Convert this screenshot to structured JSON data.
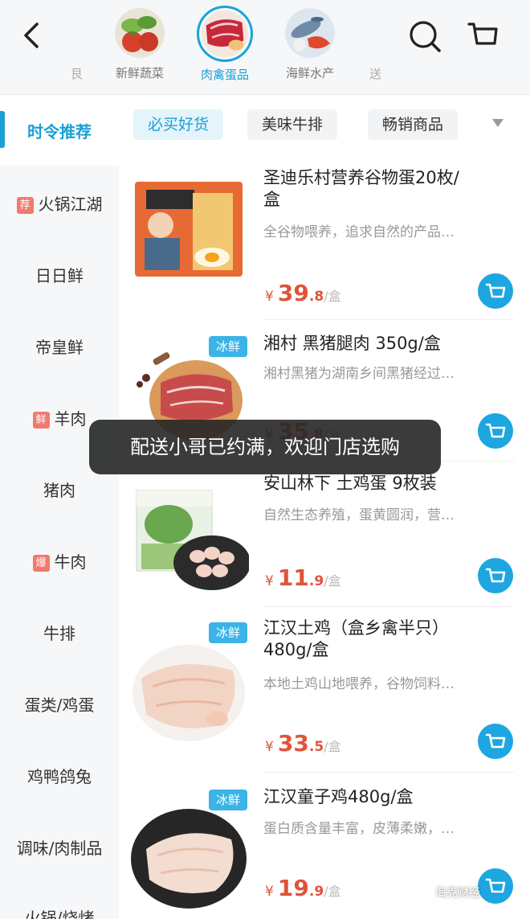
{
  "header": {
    "categories": [
      {
        "label": "新鲜蔬菜",
        "icon": "vegetables-icon",
        "active": false
      },
      {
        "label": "肉禽蛋品",
        "icon": "meat-icon",
        "active": true
      },
      {
        "label": "海鲜水产",
        "icon": "seafood-icon",
        "active": false
      }
    ],
    "left_edge_label": "艮",
    "right_edge_label": "送"
  },
  "sidebar": {
    "active": "时令推荐",
    "items": [
      {
        "label": "火锅江湖",
        "tag": "荐"
      },
      {
        "label": "日日鲜",
        "tag": ""
      },
      {
        "label": "帝皇鲜",
        "tag": ""
      },
      {
        "label": "羊肉",
        "tag": "鲜"
      },
      {
        "label": "猪肉",
        "tag": ""
      },
      {
        "label": "牛肉",
        "tag": "爆"
      },
      {
        "label": "牛排",
        "tag": ""
      },
      {
        "label": "蛋类/鸡蛋",
        "tag": ""
      },
      {
        "label": "鸡鸭鸽兔",
        "tag": ""
      },
      {
        "label": "调味/肉制品",
        "tag": ""
      },
      {
        "label": "火锅/烧烤",
        "tag": ""
      }
    ]
  },
  "subtabs": [
    {
      "label": "必买好货",
      "active": true
    },
    {
      "label": "美味牛排",
      "active": false
    },
    {
      "label": "畅销商品",
      "active": false
    }
  ],
  "products": [
    {
      "name_line1": "圣迪乐村营养谷物蛋20枚/",
      "name_line2": "盒",
      "desc": "全谷物喂养，追求自然的产品…",
      "badge": "",
      "currency": "¥",
      "price_int": "39",
      "price_dec": ".8",
      "unit": "/盒"
    },
    {
      "name_line1": "湘村 黑猪腿肉 350g/盒",
      "name_line2": "",
      "desc": "湘村黑猪为湖南乡间黑猪经过…",
      "badge": "冰鲜",
      "currency": "¥",
      "price_int": "35",
      "price_dec": ".8",
      "unit": "/盒"
    },
    {
      "name_line1": "安山林下 土鸡蛋 9枚装",
      "name_line2": "",
      "desc": "自然生态养殖，蛋黄圆润，营…",
      "badge": "",
      "currency": "¥",
      "price_int": "11",
      "price_dec": ".9",
      "unit": "/盒"
    },
    {
      "name_line1": "江汉土鸡（盒乡禽半只）",
      "name_line2": "480g/盒",
      "desc": "本地土鸡山地喂养，谷物饲料…",
      "badge": "冰鲜",
      "currency": "¥",
      "price_int": "33",
      "price_dec": ".5",
      "unit": "/盒"
    },
    {
      "name_line1": "江汉童子鸡480g/盒",
      "name_line2": "",
      "desc": "蛋白质含量丰富，皮薄柔嫩，…",
      "badge": "冰鲜",
      "currency": "¥",
      "price_int": "19",
      "price_dec": ".9",
      "unit": "/盒"
    }
  ],
  "toast": "配送小哥已约满，欢迎门店选购",
  "watermark": "海克财经",
  "colors": {
    "accent": "#1a9fd6",
    "price": "#e0543a",
    "tag": "#f07a6e",
    "badge": "#3bb3e6"
  }
}
